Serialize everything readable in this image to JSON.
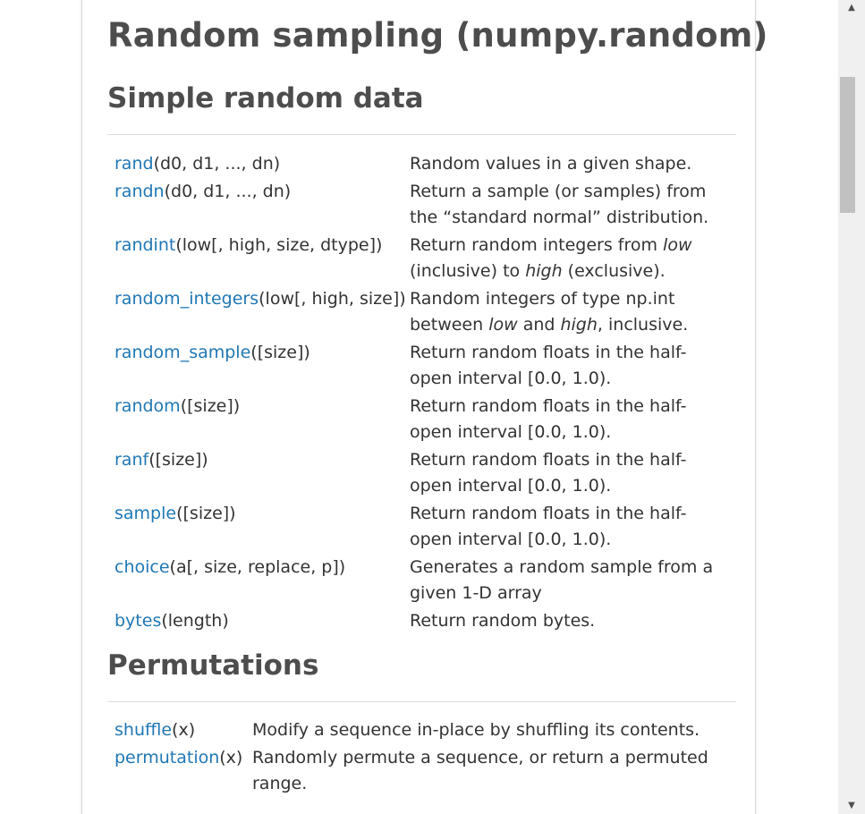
{
  "page": {
    "title": "Random sampling (numpy.random)"
  },
  "sections": [
    {
      "title": "Simple random data",
      "rows": [
        {
          "name": "rand",
          "sig": "(d0, d1, ..., dn)",
          "desc": [
            "Random values in a given shape."
          ]
        },
        {
          "name": "randn",
          "sig": "(d0, d1, ..., dn)",
          "desc": [
            "Return a sample (or samples) from",
            "the “standard normal” distribution."
          ]
        },
        {
          "name": "randint",
          "sig": "(low[, high, size, dtype])",
          "desc": [
            "Return random integers from ",
            "low",
            "",
            "(inclusive) to ",
            "high",
            " (exclusive)."
          ]
        },
        {
          "name": "random_integers",
          "sig": "(low[, high, size])",
          "desc": [
            "Random integers of type np.int",
            "between ",
            "low",
            " and ",
            "high",
            ", inclusive."
          ]
        },
        {
          "name": "random_sample",
          "sig": "([size])",
          "desc": [
            "Return random floats in the half-",
            "open interval [0.0, 1.0)."
          ]
        },
        {
          "name": "random",
          "sig": "([size])",
          "desc": [
            "Return random floats in the half-",
            "open interval [0.0, 1.0)."
          ]
        },
        {
          "name": "ranf",
          "sig": "([size])",
          "desc": [
            "Return random floats in the half-",
            "open interval [0.0, 1.0)."
          ]
        },
        {
          "name": "sample",
          "sig": "([size])",
          "desc": [
            "Return random floats in the half-",
            "open interval [0.0, 1.0)."
          ]
        },
        {
          "name": "choice",
          "sig": "(a[, size, replace, p])",
          "desc": [
            "Generates a random sample from a",
            "given 1-D array"
          ]
        },
        {
          "name": "bytes",
          "sig": "(length)",
          "desc": [
            "Return random bytes."
          ]
        }
      ]
    },
    {
      "title": "Permutations",
      "rows": [
        {
          "name": "shuffle",
          "sig": "(x)",
          "desc": [
            "Modify a sequence in-place by shuffling its contents."
          ]
        },
        {
          "name": "permutation",
          "sig": "(x)",
          "desc": [
            "Randomly permute a sequence, or return a permuted",
            "range."
          ]
        }
      ]
    }
  ],
  "scrollbar": {
    "up_icon": "triangle-up-icon",
    "down_icon": "triangle-down-icon"
  }
}
